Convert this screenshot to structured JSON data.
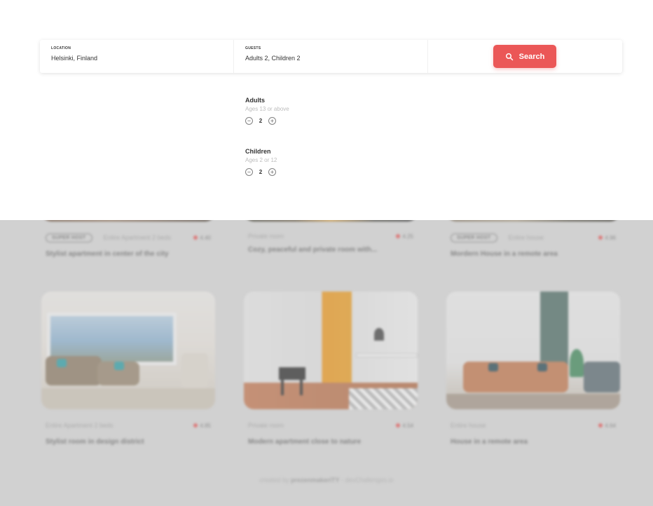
{
  "search": {
    "location_label": "LOCATION",
    "location_value": "Helsinki, Finland",
    "guests_label": "GUESTS",
    "guests_value": "Adults 2, Children 2",
    "button_label": "Search"
  },
  "guests": {
    "adults": {
      "title": "Adults",
      "subtitle": "Ages 13 or above",
      "count": "2"
    },
    "children": {
      "title": "Children",
      "subtitle": "Ages 2 or 12",
      "count": "2"
    }
  },
  "stays": [
    {
      "superhost": "SUPER HOST",
      "type": "Entire Apartment 2 beds",
      "rating": "4.40",
      "title": "Stylist apartment in center of the city"
    },
    {
      "superhost": "",
      "type": "Private room",
      "rating": "4.25",
      "title": "Cozy, peaceful and private room with..."
    },
    {
      "superhost": "SUPER HOST",
      "type": "Entire house",
      "rating": "4.96",
      "title": "Mordern House in a remote area"
    },
    {
      "superhost": "",
      "type": "Entire Apartment 2 beds",
      "rating": "4.85",
      "title": "Stylist room in design district"
    },
    {
      "superhost": "",
      "type": "Private room",
      "rating": "4.54",
      "title": "Modern apartment close to nature"
    },
    {
      "superhost": "",
      "type": "Entire house",
      "rating": "4.64",
      "title": "House in a remote area"
    }
  ],
  "footer": {
    "prefix": "created by",
    "author": "prezenmakeriTY",
    "suffix": "- devChallenges.io"
  },
  "colors": {
    "accent": "#eb5757",
    "overlay_bg": "#ffffff",
    "dim_bg": "#dcdcdc"
  },
  "icons": {
    "search": "search-icon",
    "minus": "minus-circle-icon",
    "plus": "plus-circle-icon",
    "star": "star-icon"
  }
}
